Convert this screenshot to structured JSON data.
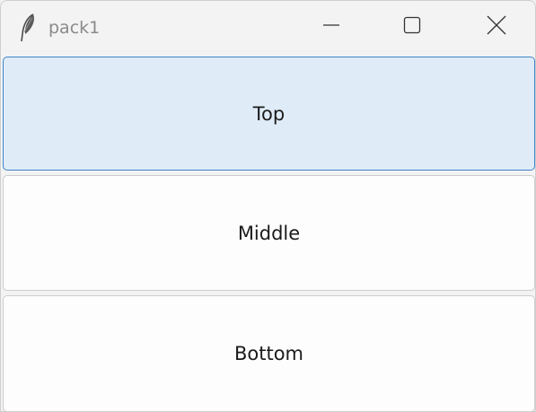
{
  "window": {
    "title": "pack1",
    "app_icon": "feather-icon",
    "controls": {
      "minimize_icon": "minimize-icon",
      "maximize_icon": "maximize-icon",
      "close_icon": "close-icon"
    }
  },
  "buttons": {
    "top": {
      "label": "Top",
      "state": "hovered"
    },
    "middle": {
      "label": "Middle"
    },
    "bottom": {
      "label": "Bottom"
    }
  },
  "colors": {
    "hover_background": "#dfecf8",
    "hover_border": "#3f83c6",
    "button_background": "#fdfdfd",
    "button_border": "#cccccc",
    "titlebar_background": "#f3f3f3",
    "title_text": "#8a8a8a"
  }
}
